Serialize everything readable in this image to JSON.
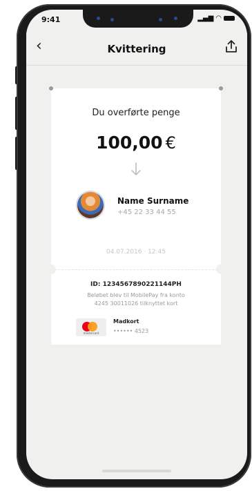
{
  "status_bar": {
    "time": "9:41"
  },
  "navbar": {
    "back_icon": "‹",
    "title": "Kvittering",
    "share_icon": "share-icon"
  },
  "receipt": {
    "heading": "Du overførte penge",
    "amount": "100,00",
    "currency": "€",
    "arrow_icon": "arrow-down-icon",
    "recipient": {
      "name": "Name Surname",
      "phone": "+45 22 33 44 55"
    },
    "date": "04.07.2016 · 12:45",
    "transaction_id": "ID: 1234567890221144PH",
    "info_line_1": "Beløbet blev til MobilePay fra konto",
    "info_line_2": "4245 30011026 tilknyttet kort",
    "card": {
      "brand_text": "mastercard",
      "name": "Madkort",
      "number": "•••••• 4523"
    }
  },
  "colors": {
    "screen_bg": "#f0f0ee",
    "card_bg": "#ffffff",
    "text_dark": "#111111",
    "text_muted": "#a8a8a8",
    "mastercard_red": "#eb001b",
    "mastercard_yellow": "#f79e1b"
  }
}
